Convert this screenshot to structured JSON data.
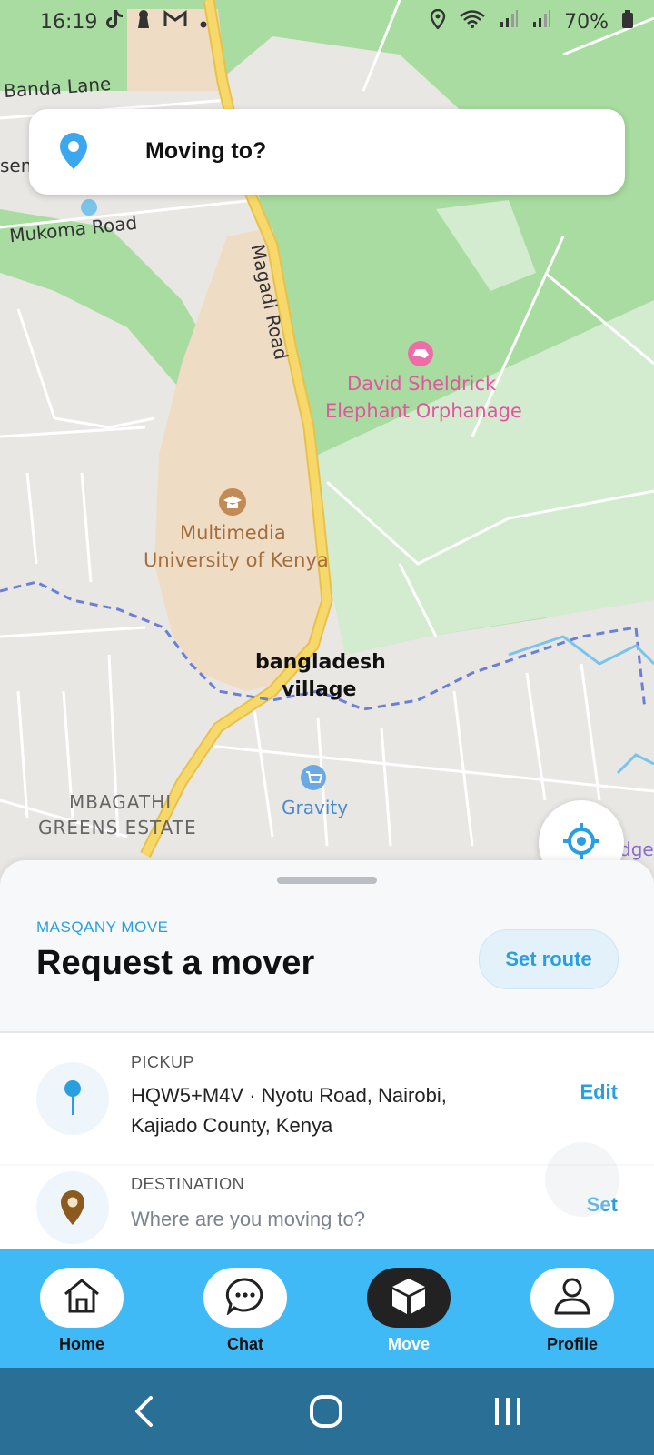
{
  "status_bar": {
    "time": "16:19",
    "battery": "70%",
    "icons": [
      "tiktok-icon",
      "keyhole-icon",
      "gmail-icon",
      "dot-icon",
      "location-icon",
      "wifi-icon",
      "signal-icon",
      "signal-icon",
      "battery-icon"
    ]
  },
  "map": {
    "labels": {
      "banda_lane": "Banda Lane",
      "sem": "sem",
      "mukoma_road": "Mukoma Road",
      "magadi_road": "Magadi Road",
      "david_line1": "David Sheldrick",
      "david_line2": "Elephant Orphanage",
      "multimedia_line1": "Multimedia",
      "multimedia_line2": "University of Kenya",
      "bangladesh_line1": "bangladesh",
      "bangladesh_line2": "village",
      "mbagathi_line1": "MBAGATHI",
      "mbagathi_line2": "GREENS ESTATE",
      "gravity": "Gravity",
      "edge": "dge"
    },
    "colors": {
      "land": "#e9e7e4",
      "park": "#a8dca0",
      "park_light": "#d3ecd0",
      "campus": "#efdcc4",
      "road_major": "#f6d96a",
      "boundary": "#6b7fd6"
    }
  },
  "search": {
    "label": "Moving to?",
    "icon": "location-pin-icon"
  },
  "sheet": {
    "brand": "MASQANY MOVE",
    "title": "Request a mover",
    "set_route": "Set route",
    "pickup": {
      "label": "PICKUP",
      "value": "HQW5+M4V · Nyotu Road, Nairobi, Kajiado County, Kenya",
      "action": "Edit"
    },
    "destination": {
      "label": "DESTINATION",
      "placeholder": "Where are you moving to?",
      "action": "Set"
    }
  },
  "nav": {
    "items": [
      {
        "label": "Home",
        "icon": "home-icon",
        "active": false
      },
      {
        "label": "Chat",
        "icon": "chat-icon",
        "active": false
      },
      {
        "label": "Move",
        "icon": "box-icon",
        "active": true
      },
      {
        "label": "Profile",
        "icon": "user-icon",
        "active": false
      }
    ]
  },
  "system_nav": [
    "back-icon",
    "home-circle-icon",
    "recents-icon"
  ]
}
